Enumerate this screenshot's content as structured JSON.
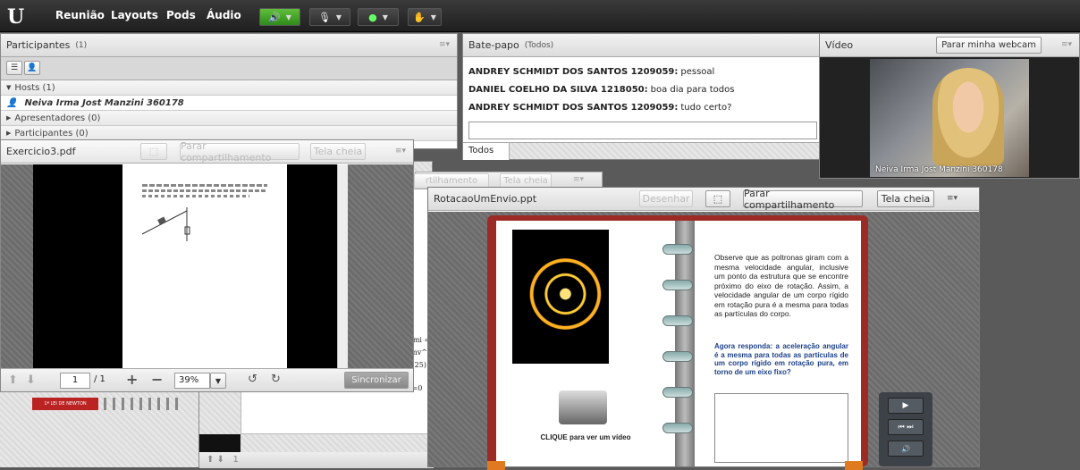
{
  "topbar": {
    "logo": "U",
    "menus": [
      "Reunião",
      "Layouts",
      "Pods",
      "Áudio"
    ]
  },
  "participants": {
    "title": "Participantes",
    "count": "(1)",
    "hosts_label": "Hosts (1)",
    "host_name": "Neiva Irma Jost Manzini 360178",
    "presenters_label": "Apresentadores (0)",
    "participants_label": "Participantes (0)"
  },
  "chat": {
    "title": "Bate-papo",
    "scope": "(Todos)",
    "messages": [
      {
        "sender": "ANDREY SCHMIDT DOS SANTOS 1209059:",
        "text": "pessoal"
      },
      {
        "sender": "DANIEL COELHO DA SILVA 1218050:",
        "text": "boa dia para todos"
      },
      {
        "sender": "ANDREY SCHMIDT DOS SANTOS 1209059:",
        "text": "tudo certo?"
      }
    ],
    "tab": "Todos"
  },
  "video": {
    "title": "Vídeo",
    "stop_webcam": "Parar minha webcam",
    "caption": "Neiva Irma Jost Manzini 360178"
  },
  "pdf_pod": {
    "title": "Exercicio3.pdf",
    "stop_share": "Parar compartilhamento",
    "fullscreen": "Tela cheia",
    "page_current": "1",
    "page_total": "/ 1",
    "zoom": "39%",
    "sync": "Sincronizar"
  },
  "back_pod": {
    "stop_share_partial": "rtilhamento",
    "fullscreen": "Tela cheia",
    "thumb_label": "1ª LEI DE NEWTON",
    "page_num": "1",
    "side_text": [
      "Emi =",
      "(mv^2",
      "2.25)",
      "x=0"
    ]
  },
  "ppt_pod": {
    "title": "RotacaoUmEnvio.ppt",
    "draw": "Desenhar",
    "stop_share": "Parar compartilhamento",
    "fullscreen": "Tela cheia",
    "slide_text": "Observe que as poltronas giram com a mesma velocidade angular, inclusive um ponto da estrutura que se encontre próximo do eixo de rotação. Assim, a velocidade angular de um corpo rígido em rotação pura é a mesma para todas as partículas do corpo.",
    "slide_question": "Agora responda: a aceleração angular é a mesma para todas as partículas de um corpo rígido em rotação pura, em torno de um eixo fixo?",
    "video_link": "CLIQUE para ver um vídeo"
  }
}
